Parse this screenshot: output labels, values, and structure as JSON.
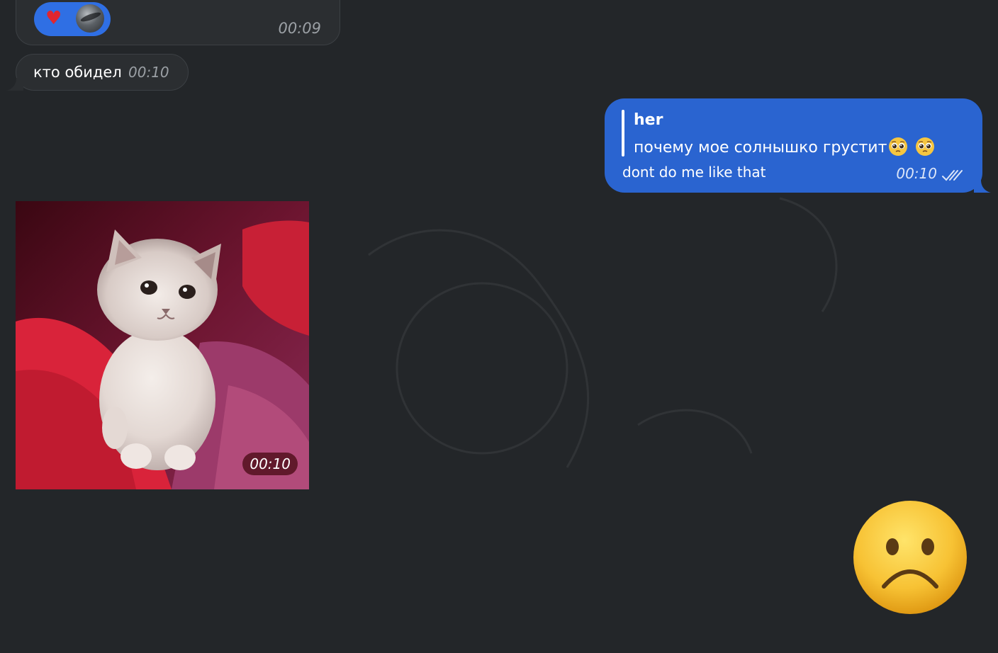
{
  "messages": {
    "top_incoming": {
      "time": "00:09",
      "reaction": {
        "emoji": "♥",
        "avatar_icon": "user-avatar"
      }
    },
    "incoming_text": {
      "text": "кто обидел",
      "time": "00:10"
    },
    "outgoing_reply": {
      "reply_author": "her",
      "reply_text": "почему мое солнышко грустит",
      "reply_emojis": [
        "pleading-face",
        "pleading-face"
      ],
      "text": "dont do me like that",
      "time": "00:10",
      "status_icon": "double-check-icon"
    },
    "photo": {
      "time": "00:10",
      "subject": "kitten-photo"
    },
    "sticker": {
      "emoji": "frowning-face"
    }
  },
  "colors": {
    "background": "#232629",
    "incoming_bubble": "#2b2e31",
    "outgoing_bubble": "#2a64d0",
    "reaction_pill": "#2f6fe4",
    "time_gray": "#9ba0a5"
  }
}
